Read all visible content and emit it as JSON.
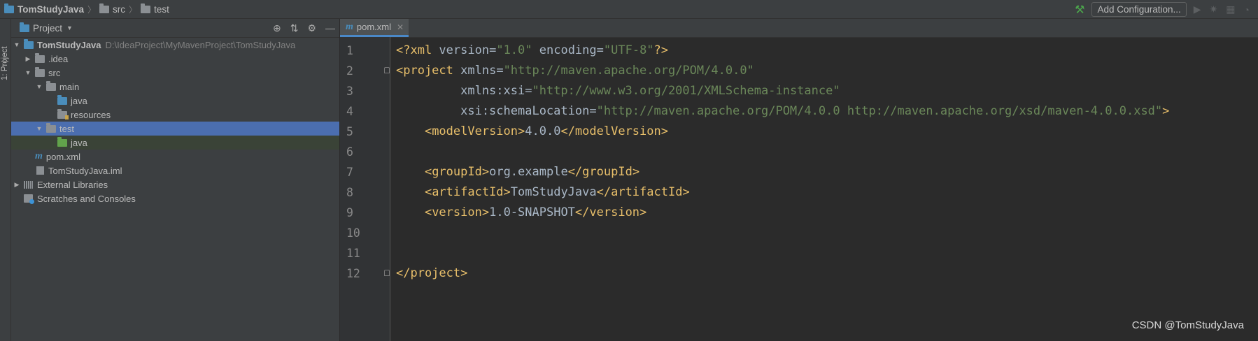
{
  "breadcrumb": {
    "project": "TomStudyJava",
    "src": "src",
    "test": "test"
  },
  "toolbar": {
    "add_configuration": "Add Configuration...",
    "icons": [
      "build-hammer-icon",
      "run-icon",
      "debug-icon",
      "coverage-icon",
      "profile-icon"
    ]
  },
  "toolstrip": {
    "project_label": "1: Project"
  },
  "project_panel": {
    "title": "Project",
    "header_icons": [
      "locate-icon",
      "collapse-all-icon",
      "settings-icon",
      "hide-icon"
    ],
    "tree": [
      {
        "label": "TomStudyJava",
        "path": "D:\\IdeaProject\\MyMavenProject\\TomStudyJava",
        "kind": "module",
        "expanded": true,
        "depth": 0
      },
      {
        "label": ".idea",
        "kind": "folder",
        "expanded": false,
        "depth": 1
      },
      {
        "label": "src",
        "kind": "folder",
        "expanded": true,
        "depth": 1
      },
      {
        "label": "main",
        "kind": "folder",
        "expanded": true,
        "depth": 2
      },
      {
        "label": "java",
        "kind": "source-root",
        "depth": 3
      },
      {
        "label": "resources",
        "kind": "resources-root",
        "depth": 3
      },
      {
        "label": "test",
        "kind": "folder",
        "expanded": true,
        "depth": 2,
        "selected": true
      },
      {
        "label": "java",
        "kind": "test-root",
        "depth": 3
      },
      {
        "label": "pom.xml",
        "kind": "maven-file",
        "depth": 1
      },
      {
        "label": "TomStudyJava.iml",
        "kind": "iml-file",
        "depth": 1
      },
      {
        "label": "External Libraries",
        "kind": "libraries",
        "expanded": false,
        "depth": 0
      },
      {
        "label": "Scratches and Consoles",
        "kind": "scratches",
        "depth": 0
      }
    ]
  },
  "editor": {
    "tab_label": "pom.xml",
    "lines": [
      {
        "n": "1",
        "text": "<?xml version=\"1.0\" encoding=\"UTF-8\"?>"
      },
      {
        "n": "2",
        "text": "<project xmlns=\"http://maven.apache.org/POM/4.0.0\""
      },
      {
        "n": "3",
        "text": "         xmlns:xsi=\"http://www.w3.org/2001/XMLSchema-instance\""
      },
      {
        "n": "4",
        "text": "         xsi:schemaLocation=\"http://maven.apache.org/POM/4.0.0 http://maven.apache.org/xsd/maven-4.0.0.xsd\">"
      },
      {
        "n": "5",
        "text": "    <modelVersion>4.0.0</modelVersion>"
      },
      {
        "n": "6",
        "text": ""
      },
      {
        "n": "7",
        "text": "    <groupId>org.example</groupId>"
      },
      {
        "n": "8",
        "text": "    <artifactId>TomStudyJava</artifactId>"
      },
      {
        "n": "9",
        "text": "    <version>1.0-SNAPSHOT</version>"
      },
      {
        "n": "10",
        "text": ""
      },
      {
        "n": "11",
        "text": ""
      },
      {
        "n": "12",
        "text": "</project>"
      }
    ]
  },
  "watermark": "CSDN @TomStudyJava",
  "colors": {
    "background": "#2b2b2b",
    "panel": "#3c3f41",
    "selection": "#4b6eaf",
    "tag": "#e8bf6a",
    "string": "#6a8759",
    "namespace": "#9876aa",
    "text": "#a9b7c6"
  }
}
